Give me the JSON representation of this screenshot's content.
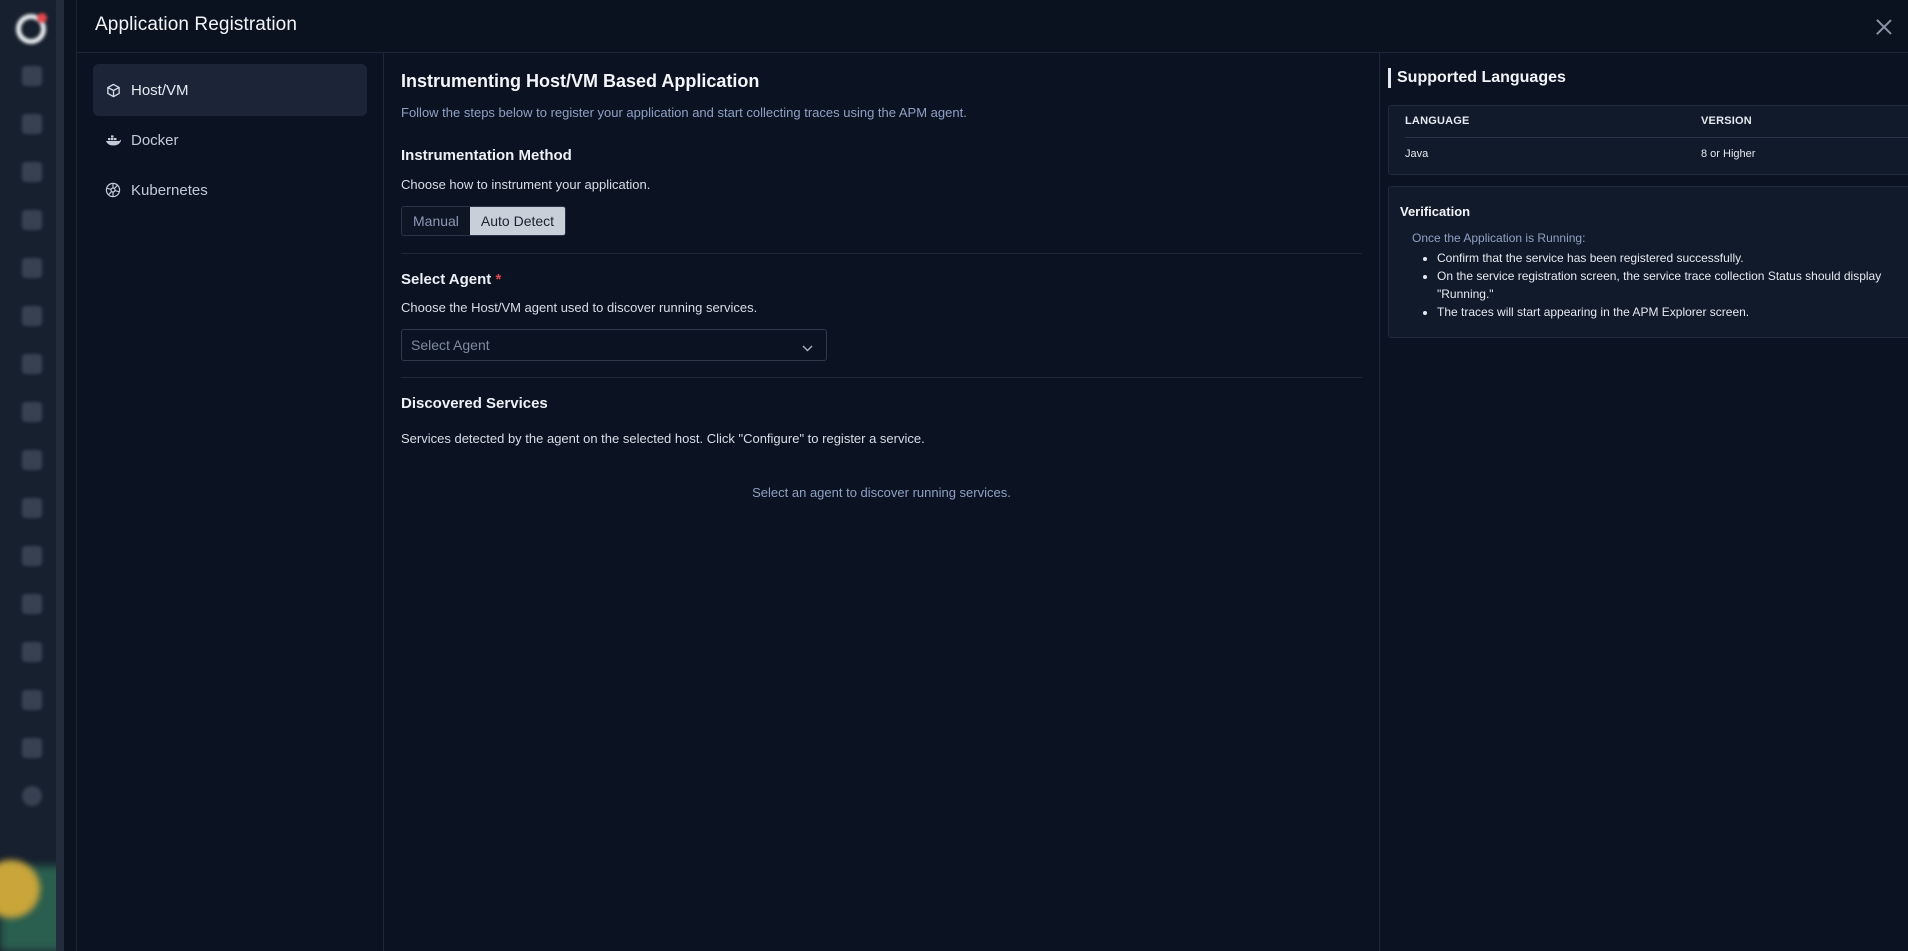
{
  "modal": {
    "title": "Application Registration"
  },
  "nav": {
    "items": [
      {
        "label": "Host/VM",
        "icon": "cube-icon",
        "active": true
      },
      {
        "label": "Docker",
        "icon": "docker-icon",
        "active": false
      },
      {
        "label": "Kubernetes",
        "icon": "kubernetes-icon",
        "active": false
      }
    ]
  },
  "main": {
    "title": "Instrumenting Host/VM Based Application",
    "subtitle": "Follow the steps below to register your application and start collecting traces using the APM agent.",
    "method": {
      "title": "Instrumentation Method",
      "desc": "Choose how to instrument your application.",
      "options": [
        "Manual",
        "Auto Detect"
      ],
      "selected": "Auto Detect"
    },
    "agent": {
      "title": "Select Agent",
      "required_mark": "*",
      "desc": "Choose the Host/VM agent used to discover running services.",
      "placeholder": "Select Agent"
    },
    "services": {
      "title": "Discovered Services",
      "desc": "Services detected by the agent on the selected host. Click \"Configure\" to register a service.",
      "empty": "Select an agent to discover running services."
    }
  },
  "languages": {
    "title": "Supported Languages",
    "headers": [
      "LANGUAGE",
      "VERSION"
    ],
    "rows": [
      [
        "Java",
        "8 or Higher"
      ]
    ]
  },
  "verification": {
    "title": "Verification",
    "lead": "Once the Application is Running:",
    "items": [
      "Confirm that the service has been registered successfully.",
      "On the service registration screen, the service trace collection Status should display",
      "\"Running.\"",
      "The traces will start appearing in the APM Explorer screen."
    ]
  },
  "colors": {
    "background": "#0b1322",
    "accent_required": "#e5484d",
    "muted_text": "#8fa0c4"
  }
}
